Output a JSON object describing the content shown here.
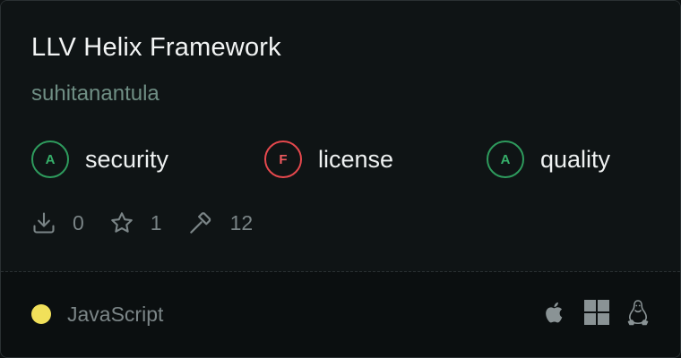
{
  "project": {
    "title": "LLV Helix Framework",
    "owner": "suhitanantula"
  },
  "grades": [
    {
      "letter": "A",
      "label": "security",
      "status": "good"
    },
    {
      "letter": "F",
      "label": "license",
      "status": "bad"
    },
    {
      "letter": "A",
      "label": "quality",
      "status": "good"
    }
  ],
  "stats": {
    "downloads": "0",
    "stars": "1",
    "builds": "12"
  },
  "footer": {
    "language": "JavaScript",
    "language_color": "#f1e05a",
    "platforms": [
      "apple-icon",
      "windows-icon",
      "linux-icon"
    ]
  },
  "colors": {
    "good": "#2e9b5d",
    "bad": "#e5484d",
    "owner": "#6f8e84"
  }
}
